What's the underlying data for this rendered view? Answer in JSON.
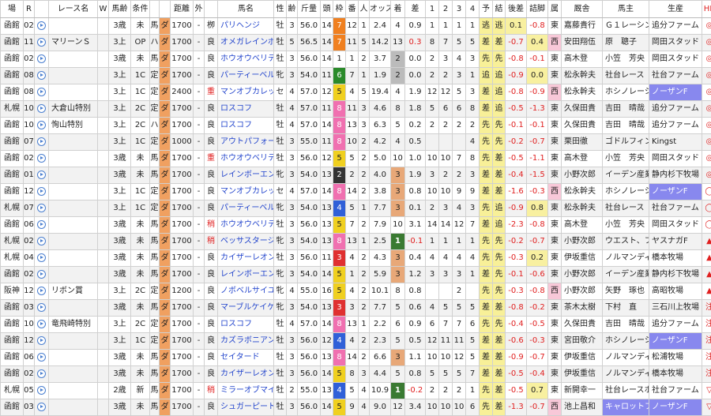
{
  "headers": [
    "場",
    "R",
    "",
    "レース名",
    "W",
    "馬齢",
    "条件",
    "",
    "",
    "距離",
    "外",
    "",
    "馬名",
    "性",
    "齢",
    "斤量",
    "頭",
    "枠",
    "番",
    "人",
    "オッズ",
    "着",
    "差",
    "1",
    "2",
    "3",
    "4",
    "予",
    "結",
    "後差",
    "詰脚",
    "属",
    "厩舎",
    "馬主",
    "生産",
    "HB"
  ],
  "rows": [
    [
      "函館",
      "02",
      "",
      "",
      "",
      "3歳",
      "未",
      "馬",
      "ダ",
      "1700",
      "-",
      "栁",
      "パリヘンジ",
      "牡",
      "3",
      "56.0",
      "14",
      "7",
      "12",
      "1",
      "2.4",
      "4",
      "0.9",
      "1",
      "1",
      "1",
      "1",
      "逃",
      "逃",
      "0.1",
      "-0.8",
      "東",
      "嘉藤貴行",
      "Ｇ１レーシン",
      "追分ファーム",
      "◎"
    ],
    [
      "函館",
      "11",
      "",
      "マリーンＳ",
      "",
      "3上",
      "OP",
      "ハ",
      "ダ",
      "1700",
      "-",
      "良",
      "オメガレインボー",
      "牡",
      "5",
      "56.5",
      "14",
      "7",
      "11",
      "5",
      "14.2",
      "13",
      "0.3",
      "8",
      "7",
      "5",
      "5",
      "差",
      "差",
      "-0.7",
      "0.4",
      "西",
      "安田翔伍",
      "原　聰子",
      "岡田スタッド",
      "◎"
    ],
    [
      "函館",
      "02",
      "",
      "",
      "",
      "3歳",
      "未",
      "馬",
      "ダ",
      "1700",
      "-",
      "良",
      "ホウオウベリテ",
      "牡",
      "3",
      "56.0",
      "14",
      "1",
      "1",
      "2",
      "3.7",
      "2",
      "0.0",
      "2",
      "3",
      "4",
      "3",
      "先",
      "先",
      "-0.8",
      "-0.1",
      "東",
      "高木登",
      "小笠　芳央",
      "岡田スタッド",
      "◎"
    ],
    [
      "函館",
      "08",
      "",
      "",
      "",
      "3上",
      "1C",
      "定",
      "ダ",
      "1700",
      "-",
      "良",
      "パーティーベル",
      "牝",
      "3",
      "54.0",
      "11",
      "6",
      "7",
      "1",
      "1.9",
      "2",
      "0.0",
      "2",
      "2",
      "3",
      "1",
      "追",
      "追",
      "-0.9",
      "0.0",
      "東",
      "松永幹夫",
      "社台レース",
      "社台ファーム",
      "◎"
    ],
    [
      "函館",
      "08",
      "",
      "",
      "",
      "3上",
      "1C",
      "定",
      "ダ",
      "2400",
      "-",
      "重",
      "マンオブカレッジ",
      "セ",
      "4",
      "57.0",
      "12",
      "5",
      "4",
      "5",
      "19.4",
      "4",
      "1.9",
      "12",
      "12",
      "5",
      "3",
      "差",
      "追",
      "-0.8",
      "-0.9",
      "西",
      "松永幹夫",
      "ホシノレーシ",
      "ノーザンF",
      "◎"
    ],
    [
      "札幌",
      "10",
      "",
      "大倉山特別",
      "",
      "3上",
      "2C",
      "定",
      "ダ",
      "1700",
      "-",
      "良",
      "ロスコフ",
      "牡",
      "4",
      "57.0",
      "11",
      "8",
      "11",
      "3",
      "4.6",
      "8",
      "1.8",
      "5",
      "6",
      "6",
      "8",
      "差",
      "追",
      "-0.5",
      "-1.3",
      "東",
      "久保田貴",
      "吉田　晴哉",
      "追分ファーム",
      "◎"
    ],
    [
      "函館",
      "10",
      "",
      "恂山特別",
      "",
      "3上",
      "2C",
      "ハ",
      "ダ",
      "1700",
      "-",
      "良",
      "ロスコフ",
      "牡",
      "4",
      "57.0",
      "14",
      "8",
      "13",
      "3",
      "6.3",
      "5",
      "0.2",
      "2",
      "2",
      "2",
      "2",
      "先",
      "先",
      "-0.1",
      "-0.1",
      "東",
      "久保田貴",
      "吉田　晴哉",
      "追分ファーム",
      "◎"
    ],
    [
      "函館",
      "07",
      "",
      "",
      "",
      "3上",
      "1C",
      "定",
      "ダ",
      "1000",
      "-",
      "良",
      "アウトパフォーム",
      "牡",
      "3",
      "55.0",
      "11",
      "8",
      "10",
      "2",
      "4.2",
      "4",
      "0.5",
      "",
      "",
      "",
      "4",
      "先",
      "先",
      "-0.2",
      "-0.7",
      "東",
      "栗田徹",
      "ゴドルフィン",
      "Kingst",
      "◎"
    ],
    [
      "函館",
      "02",
      "",
      "",
      "",
      "3歳",
      "未",
      "馬",
      "ダ",
      "1700",
      "-",
      "重",
      "ホウオウベリテ",
      "牡",
      "3",
      "56.0",
      "12",
      "5",
      "5",
      "2",
      "5.0",
      "10",
      "1.0",
      "10",
      "10",
      "7",
      "8",
      "先",
      "差",
      "-0.5",
      "-1.1",
      "東",
      "高木登",
      "小笠　芳央",
      "岡田スタッド",
      "◎"
    ],
    [
      "函館",
      "01",
      "",
      "",
      "",
      "3歳",
      "未",
      "馬",
      "ダ",
      "1700",
      "-",
      "良",
      "レインボーエンゼル",
      "牝",
      "3",
      "54.0",
      "13",
      "2",
      "2",
      "2",
      "4.0",
      "3",
      "1.9",
      "3",
      "2",
      "2",
      "3",
      "差",
      "差",
      "-0.4",
      "-1.5",
      "東",
      "小野次郎",
      "イーデン産業",
      "静内杉下牧場",
      "◎"
    ],
    [
      "函館",
      "12",
      "",
      "",
      "",
      "3上",
      "1C",
      "定",
      "ダ",
      "1700",
      "-",
      "良",
      "マンオブカレッジ",
      "セ",
      "4",
      "57.0",
      "14",
      "8",
      "14",
      "2",
      "3.8",
      "3",
      "0.8",
      "10",
      "10",
      "9",
      "9",
      "差",
      "差",
      "-1.6",
      "-0.3",
      "西",
      "松永幹夫",
      "ホシノレーシ",
      "ノーザンF",
      "◯"
    ],
    [
      "札幌",
      "07",
      "",
      "",
      "",
      "3上",
      "1C",
      "定",
      "ダ",
      "1700",
      "-",
      "良",
      "パーティーベル",
      "牝",
      "3",
      "54.0",
      "13",
      "4",
      "5",
      "1",
      "7.7",
      "3",
      "0.1",
      "2",
      "3",
      "4",
      "3",
      "先",
      "追",
      "-0.9",
      "0.8",
      "東",
      "松永幹夫",
      "社台レース",
      "社台ファーム",
      "◯"
    ],
    [
      "函館",
      "06",
      "",
      "",
      "",
      "3歳",
      "未",
      "馬",
      "ダ",
      "1700",
      "-",
      "稍",
      "ホウオウベリテ",
      "牡",
      "3",
      "56.0",
      "13",
      "5",
      "7",
      "2",
      "7.9",
      "10",
      "3.1",
      "14",
      "14",
      "12",
      "7",
      "差",
      "追",
      "-2.3",
      "-0.8",
      "東",
      "高木登",
      "小笠　芳央",
      "岡田スタッド",
      "◯"
    ],
    [
      "札幌",
      "02",
      "",
      "",
      "",
      "3歳",
      "未",
      "馬",
      "ダ",
      "1700",
      "-",
      "稍",
      "ベッサスタージル",
      "牝",
      "3",
      "54.0",
      "13",
      "8",
      "13",
      "1",
      "2.5",
      "1",
      "-0.1",
      "1",
      "1",
      "1",
      "1",
      "先",
      "先",
      "-0.2",
      "-0.7",
      "東",
      "小野次郎",
      "ウエスト、フ",
      "ヤスナガF",
      "▲"
    ],
    [
      "札幌",
      "04",
      "",
      "",
      "",
      "3歳",
      "未",
      "馬",
      "ダ",
      "1700",
      "-",
      "良",
      "カイザーレオン",
      "牡",
      "3",
      "56.0",
      "11",
      "3",
      "4",
      "2",
      "4.3",
      "3",
      "0.4",
      "4",
      "4",
      "4",
      "4",
      "先",
      "先",
      "-0.3",
      "0.2",
      "東",
      "伊坂重信",
      "ノルマンディ",
      "橋本牧場",
      "▲"
    ],
    [
      "函館",
      "02",
      "",
      "",
      "",
      "3歳",
      "未",
      "馬",
      "ダ",
      "1700",
      "-",
      "良",
      "レインボーエンゼル",
      "牝",
      "3",
      "54.0",
      "14",
      "5",
      "1",
      "2",
      "5.9",
      "3",
      "1.2",
      "3",
      "3",
      "3",
      "1",
      "差",
      "先",
      "-0.1",
      "-0.6",
      "東",
      "小野次郎",
      "イーデン産業",
      "静内杉下牧場",
      "▲"
    ],
    [
      "阪神",
      "12",
      "",
      "リボン賞",
      "",
      "3上",
      "2C",
      "定",
      "ダ",
      "1200",
      "-",
      "良",
      "ノボベルサイユ",
      "牝",
      "4",
      "55.0",
      "16",
      "5",
      "4",
      "2",
      "10.1",
      "8",
      "0.8",
      "",
      "",
      "2",
      "",
      "先",
      "先",
      "-0.3",
      "-0.8",
      "西",
      "小野次郎",
      "矢野　琢也",
      "高昭牧場",
      "▲"
    ],
    [
      "函館",
      "03",
      "",
      "",
      "",
      "3歳",
      "未",
      "馬",
      "ダ",
      "1700",
      "-",
      "良",
      "マーブルケイケー",
      "牝",
      "3",
      "54.0",
      "13",
      "3",
      "3",
      "2",
      "7.7",
      "5",
      "0.6",
      "4",
      "5",
      "5",
      "5",
      "差",
      "差",
      "-0.8",
      "-0.2",
      "東",
      "茶木太樹",
      "下村　直",
      "三石川上牧場",
      "注"
    ],
    [
      "函館",
      "10",
      "",
      "竜飛崎特別",
      "",
      "3上",
      "2C",
      "定",
      "ダ",
      "1700",
      "-",
      "良",
      "ロスコフ",
      "牡",
      "4",
      "57.0",
      "14",
      "8",
      "13",
      "1",
      "2.2",
      "6",
      "0.9",
      "6",
      "7",
      "7",
      "6",
      "先",
      "先",
      "-0.4",
      "-0.5",
      "東",
      "久保田貴",
      "吉田　晴哉",
      "追分ファーム",
      "注"
    ],
    [
      "函館",
      "12",
      "",
      "",
      "",
      "3上",
      "1C",
      "定",
      "ダ",
      "1700",
      "-",
      "良",
      "カズラボニアン",
      "牡",
      "3",
      "56.0",
      "12",
      "4",
      "4",
      "2",
      "2.3",
      "5",
      "0.5",
      "12",
      "11",
      "11",
      "5",
      "差",
      "差",
      "-0.6",
      "-0.3",
      "東",
      "宮田敬介",
      "ホシノレーシ",
      "ノーザンF",
      "注"
    ],
    [
      "函館",
      "06",
      "",
      "",
      "",
      "3歳",
      "未",
      "馬",
      "ダ",
      "1700",
      "-",
      "良",
      "セイタード",
      "牡",
      "3",
      "56.0",
      "13",
      "8",
      "14",
      "2",
      "6.6",
      "3",
      "1.1",
      "10",
      "10",
      "12",
      "5",
      "差",
      "差",
      "-0.9",
      "-0.7",
      "東",
      "伊坂重信",
      "ノルマンディ",
      "松浦牧場",
      "注"
    ],
    [
      "函館",
      "02",
      "",
      "",
      "",
      "3歳",
      "未",
      "馬",
      "ダ",
      "1700",
      "-",
      "良",
      "カイザーレオン",
      "牡",
      "3",
      "56.0",
      "14",
      "5",
      "8",
      "3",
      "4.4",
      "5",
      "0.8",
      "5",
      "5",
      "5",
      "7",
      "差",
      "差",
      "-0.5",
      "-0.4",
      "東",
      "伊坂重信",
      "ノルマンディ",
      "橋本牧場",
      "注"
    ],
    [
      "札幌",
      "05",
      "",
      "",
      "",
      "2歳",
      "新",
      "馬",
      "ダ",
      "1700",
      "-",
      "稍",
      "ミラーオブマインド",
      "牡",
      "2",
      "55.0",
      "13",
      "4",
      "5",
      "4",
      "10.9",
      "1",
      "-0.2",
      "2",
      "2",
      "2",
      "1",
      "先",
      "差",
      "-0.5",
      "0.7",
      "東",
      "新開幸一",
      "社台レースホ",
      "社台ファーム",
      "▽"
    ],
    [
      "函館",
      "03",
      "",
      "",
      "",
      "3歳",
      "未",
      "馬",
      "ダ",
      "1700",
      "-",
      "良",
      "シュガーピート",
      "牡",
      "3",
      "56.0",
      "14",
      "5",
      "9",
      "4",
      "9.0",
      "12",
      "3.4",
      "10",
      "10",
      "10",
      "6",
      "先",
      "差",
      "-1.3",
      "-0.7",
      "西",
      "池上昌和",
      "キャロットフ",
      "ノーザンF",
      "▽"
    ]
  ]
}
